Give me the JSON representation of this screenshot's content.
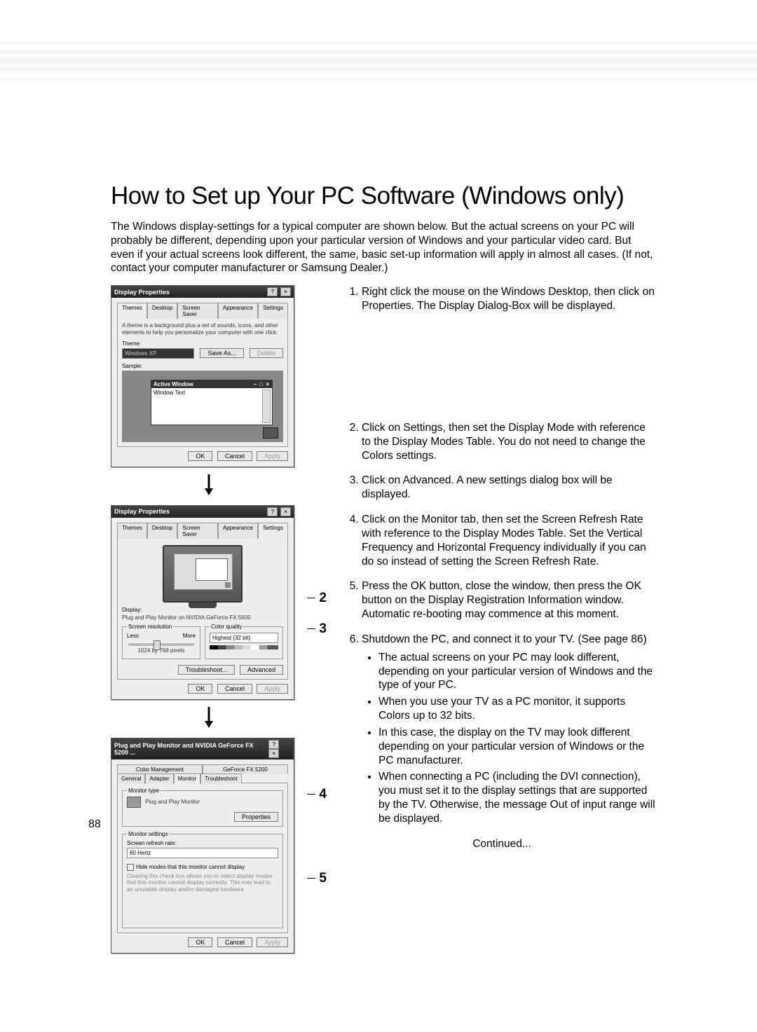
{
  "page_number": "88",
  "title": "How to Set up Your PC Software (Windows only)",
  "intro": "The Windows display-settings for a typical computer are shown below. But the actual screens on your PC will probably be different, depending upon your particular version of Windows and your particular video card. But even if your actual screens look different, the same, basic set-up information will apply in almost all cases. (If not, contact your computer manufacturer or Samsung Dealer.)",
  "steps": {
    "s1": "Right click the mouse on the Windows Desktop, then click on Properties. The Display Dialog-Box will be displayed.",
    "s2": "Click on Settings, then set the Display Mode with reference to the Display Modes Table. You do not need to change the Colors settings.",
    "s3": "Click on Advanced. A new settings dialog box will be displayed.",
    "s4": "Click on the Monitor tab, then set the Screen Refresh Rate with reference to the Display Modes Table. Set the Vertical Frequency and Horizontal Frequency individually if you can do so instead of setting the Screen Refresh Rate.",
    "s5": "Press the OK button, close the window, then press the OK button on the Display Registration Information window. Automatic re-booting may commence at this moment.",
    "s6": "Shutdown the PC, and connect it to your TV. (See page 86)"
  },
  "notes": {
    "n1": "The actual screens on your PC may look different, depending on your particular version of Windows and the type of your PC.",
    "n2": "When you use your TV as a PC monitor, it supports Colors up to 32 bits.",
    "n3": "In this case, the display on the TV may look different depending on your particular version of Windows or the PC manufacturer.",
    "n4": "When connecting a PC (including the DVI connection), you must set it to the display settings that are supported by the TV. Otherwise, the message Out of input range will be displayed."
  },
  "continued": "Continued...",
  "callouts": {
    "c2": "2",
    "c3": "3",
    "c4": "4",
    "c5": "5"
  },
  "dlg1": {
    "title": "Display Properties",
    "tabs": {
      "t1": "Themes",
      "t2": "Desktop",
      "t3": "Screen Saver",
      "t4": "Appearance",
      "t5": "Settings"
    },
    "blurb": "A theme is a background plus a set of sounds, icons, and other elements to help you personalize your computer with one click.",
    "theme_label": "Theme:",
    "theme_value": "Windows XP",
    "saveas": "Save As...",
    "delete": "Delete",
    "sample_label": "Sample:",
    "active_window": "Active Window",
    "window_text": "Window Text",
    "ok": "OK",
    "cancel": "Cancel",
    "apply": "Apply"
  },
  "dlg2": {
    "title": "Display Properties",
    "tabs": {
      "t1": "Themes",
      "t2": "Desktop",
      "t3": "Screen Saver",
      "t4": "Appearance",
      "t5": "Settings"
    },
    "display_label": "Display:",
    "display_value": "Plug and Play Monitor on NVIDIA GeForce FX 5600",
    "res_legend": "Screen resolution",
    "less": "Less",
    "more": "More",
    "res_value": "1024 by 768 pixels",
    "color_legend": "Color quality",
    "color_value": "Highest (32 bit)",
    "troubleshoot": "Troubleshoot...",
    "advanced": "Advanced",
    "ok": "OK",
    "cancel": "Cancel",
    "apply": "Apply"
  },
  "dlg3": {
    "title": "Plug and Play Monitor and NVIDIA GeForce FX 5200 ...",
    "tabsA": {
      "t1": "Color Management",
      "t2": "GeForce FX 5200"
    },
    "tabsB": {
      "t1": "General",
      "t2": "Adapter",
      "t3": "Monitor",
      "t4": "Troubleshoot"
    },
    "montype_legend": "Monitor type",
    "montype_value": "Plug and Play Monitor",
    "properties": "Properties",
    "monset_legend": "Monitor settings",
    "refresh_label": "Screen refresh rate:",
    "refresh_value": "60 Hertz",
    "hide_label": "Hide modes that this monitor cannot display",
    "hide_blurb": "Clearing this check box allows you to select display modes that this monitor cannot display correctly. This may lead to an unusable display and/or damaged hardware.",
    "ok": "OK",
    "cancel": "Cancel",
    "apply": "Apply"
  }
}
